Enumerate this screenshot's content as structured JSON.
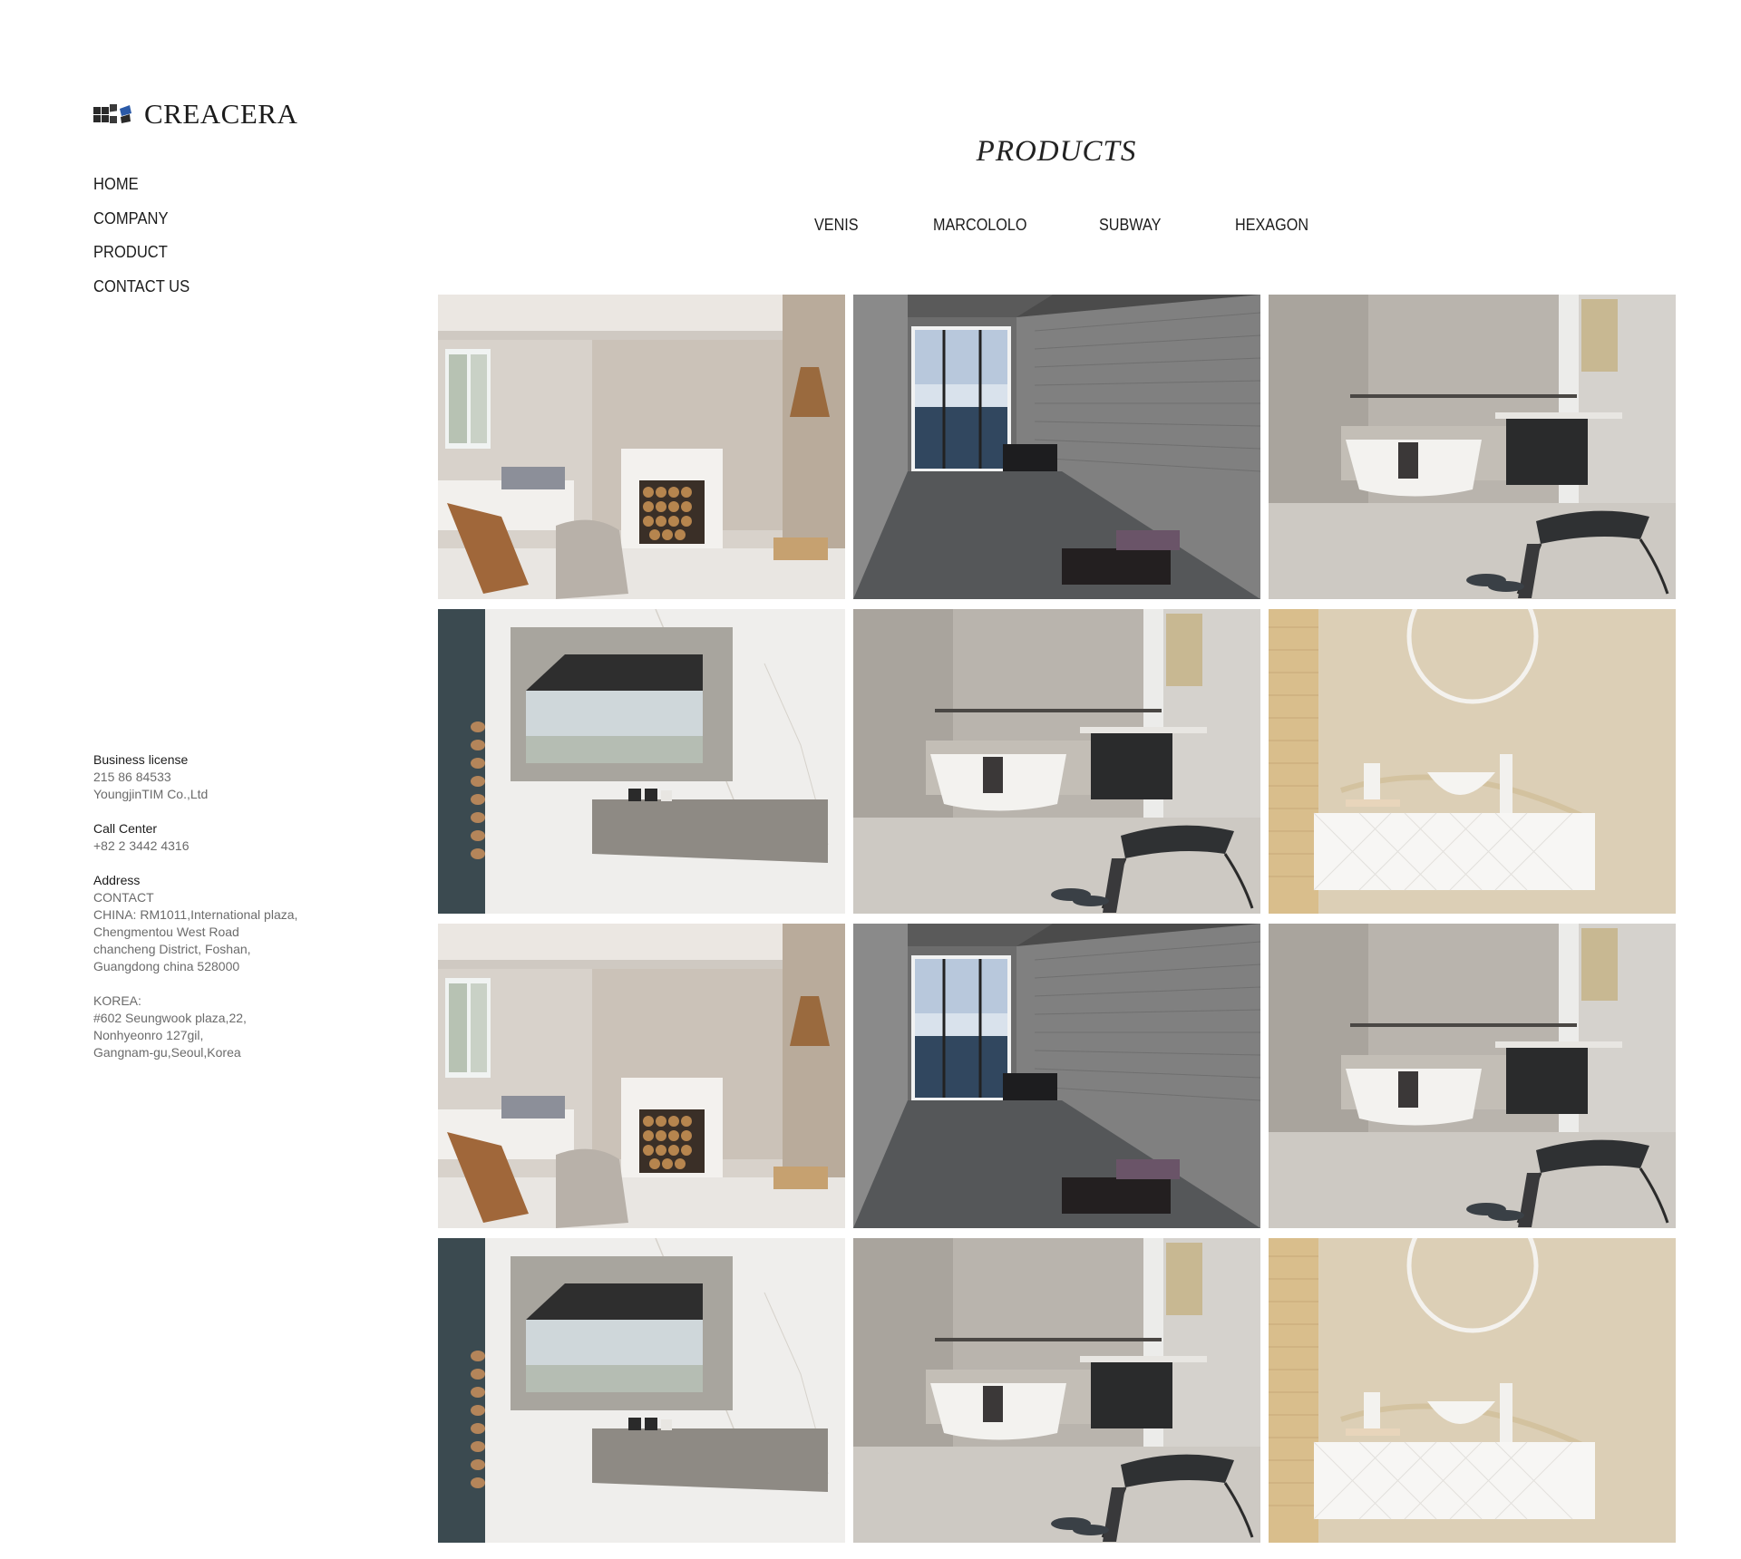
{
  "brand": {
    "name": "CREACERA",
    "logo_icon": "tile-logo-icon"
  },
  "nav": [
    {
      "label": "HOME"
    },
    {
      "label": "COMPANY"
    },
    {
      "label": "PRODUCT"
    },
    {
      "label": "CONTACT US"
    }
  ],
  "info": {
    "business": {
      "label": "Business license",
      "lines": [
        "215 86 84533",
        "YoungjinTIM Co.,Ltd"
      ]
    },
    "call": {
      "label": "Call Center",
      "lines": [
        "+82 2 3442 4316"
      ]
    },
    "address": {
      "label": "Address",
      "lines": [
        "CONTACT",
        "CHINA: RM1011,International plaza,",
        "Chengmentou West Road",
        "chancheng District, Foshan,",
        "Guangdong china 528000"
      ]
    },
    "korea": {
      "lines": [
        "KOREA:",
        "#602 Seungwook plaza,22,",
        "Nonhyeonro 127gil,",
        "Gangnam-gu,Seoul,Korea"
      ]
    }
  },
  "page": {
    "title": "PRODUCTS"
  },
  "tabs": [
    {
      "label": "VENIS"
    },
    {
      "label": "MARCOLOLO"
    },
    {
      "label": "SUBWAY"
    },
    {
      "label": "HEXAGON"
    }
  ],
  "products": [
    {
      "scene": "living-room"
    },
    {
      "scene": "corridor-sea-view"
    },
    {
      "scene": "gray-bathroom"
    },
    {
      "scene": "marble-wall-shelf"
    },
    {
      "scene": "gray-bathroom"
    },
    {
      "scene": "beige-vanity"
    },
    {
      "scene": "living-room"
    },
    {
      "scene": "corridor-sea-view"
    },
    {
      "scene": "gray-bathroom"
    },
    {
      "scene": "marble-wall-shelf"
    },
    {
      "scene": "gray-bathroom"
    },
    {
      "scene": "beige-vanity"
    }
  ]
}
